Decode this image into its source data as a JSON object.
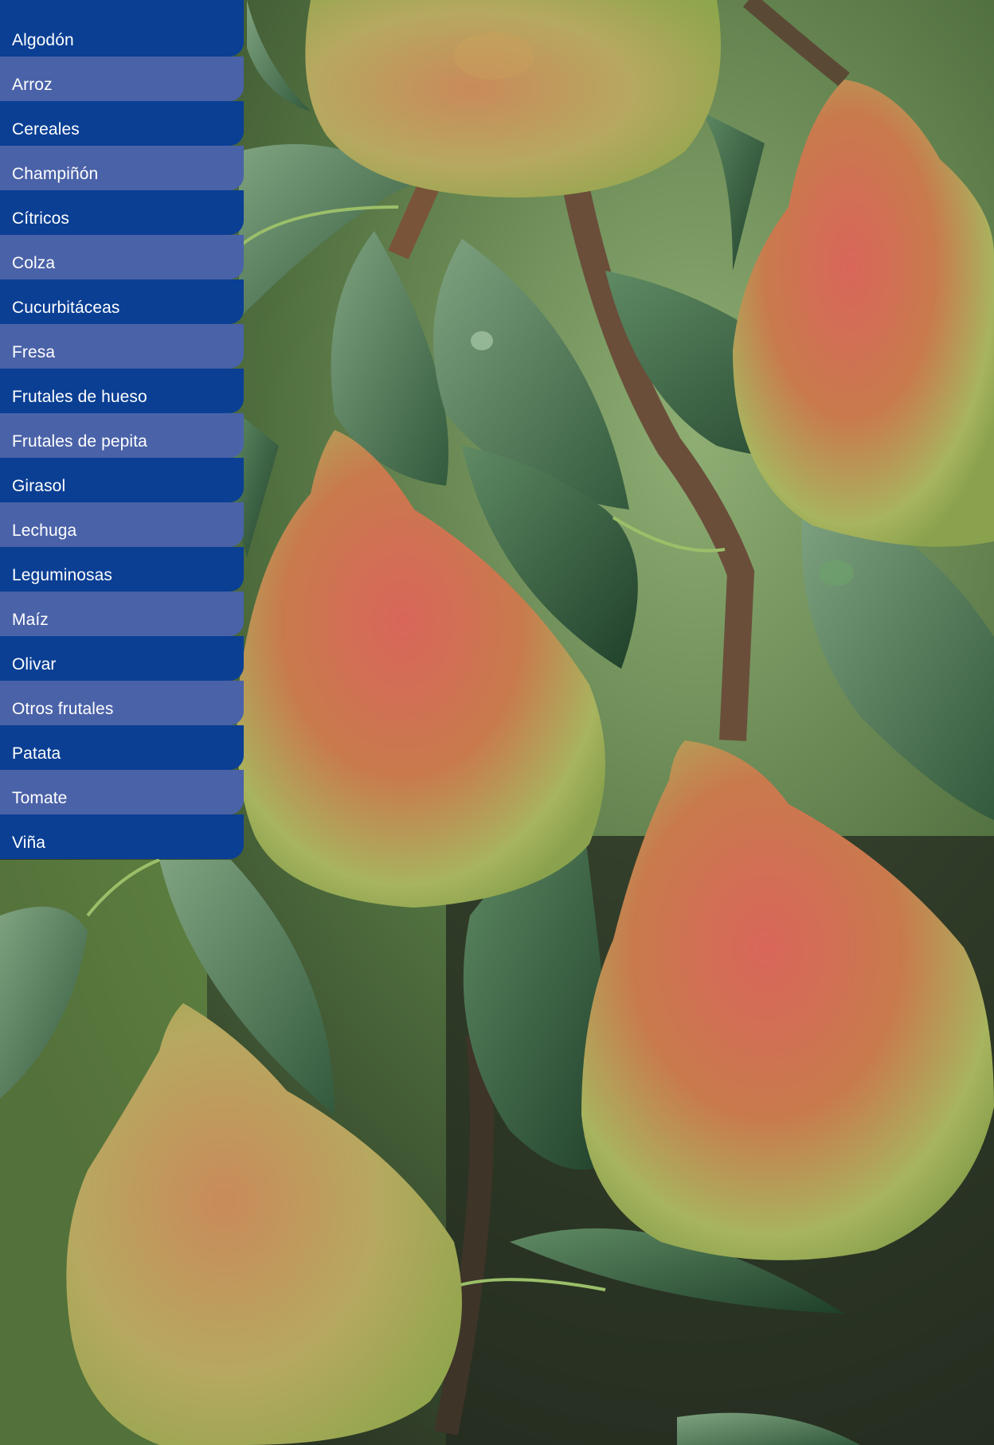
{
  "menu": {
    "items": [
      {
        "label": "Algodón"
      },
      {
        "label": "Arroz"
      },
      {
        "label": "Cereales"
      },
      {
        "label": "Champiñón"
      },
      {
        "label": "Cítricos"
      },
      {
        "label": "Colza"
      },
      {
        "label": "Cucurbitáceas"
      },
      {
        "label": "Fresa"
      },
      {
        "label": "Frutales de hueso"
      },
      {
        "label": "Frutales de pepita"
      },
      {
        "label": "Girasol"
      },
      {
        "label": "Lechuga"
      },
      {
        "label": "Leguminosas"
      },
      {
        "label": "Maíz"
      },
      {
        "label": "Olivar"
      },
      {
        "label": "Otros frutales"
      },
      {
        "label": "Patata"
      },
      {
        "label": "Tomate"
      },
      {
        "label": "Viña"
      }
    ],
    "colors": {
      "dark": "#0a3f94",
      "light": "#4a62a8",
      "text": "#ffffff"
    }
  },
  "background": {
    "subject": "pears-on-branch-photo"
  }
}
